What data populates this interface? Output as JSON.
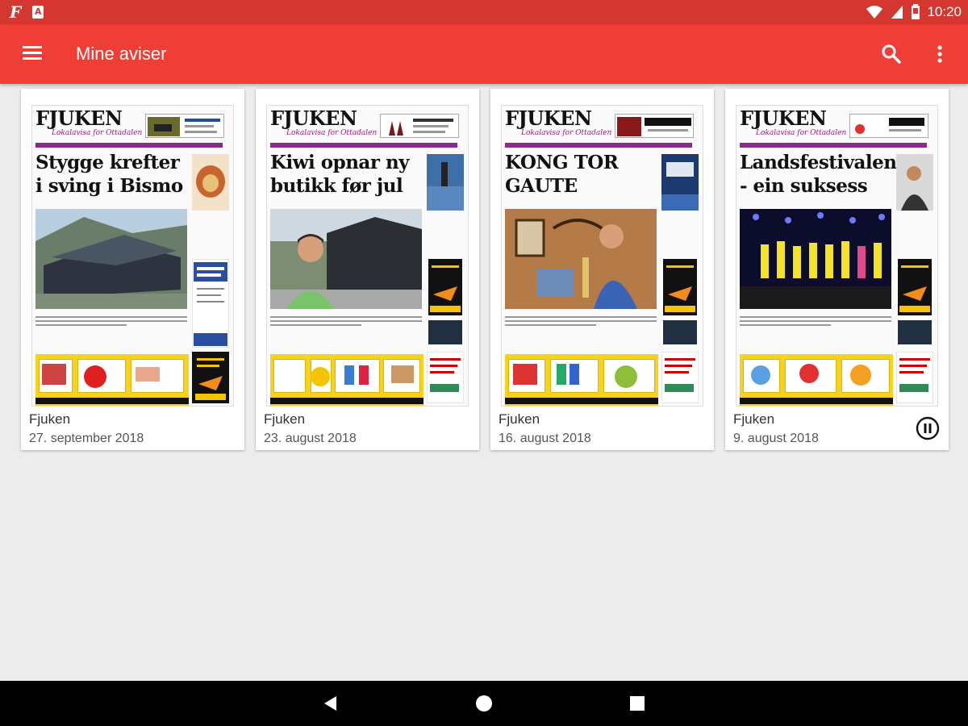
{
  "status_bar": {
    "time": "10:20",
    "app_icon_letter": "F",
    "notification_icon_letter": "A",
    "icons": [
      "wifi-icon",
      "cell-signal-icon",
      "battery-icon"
    ],
    "color": "#d33730"
  },
  "app_bar": {
    "title": "Mine aviser",
    "color": "#ef3e36",
    "icons": [
      "menu-icon",
      "search-icon",
      "more-vert-icon"
    ]
  },
  "papers": [
    {
      "name": "Fjuken",
      "date": "27. september 2018",
      "logo": "FJUKEN",
      "tagline": "Lokalavisa for Ottadalen",
      "headline": "Stygge krefter i sving i Bismo"
    },
    {
      "name": "Fjuken",
      "date": "23. august 2018",
      "logo": "FJUKEN",
      "tagline": "Lokalavisa for Ottadalen",
      "headline": "Kiwi opnar ny butikk før jul"
    },
    {
      "name": "Fjuken",
      "date": "16. august 2018",
      "logo": "FJUKEN",
      "tagline": "Lokalavisa for Ottadalen",
      "headline": "KONG TOR GAUTE"
    },
    {
      "name": "Fjuken",
      "date": "9. august 2018",
      "logo": "FJUKEN",
      "tagline": "Lokalavisa for Ottadalen",
      "headline": "Landsfestivalen - ein suksess",
      "download_state_icon": "pause-icon"
    }
  ],
  "nav_bar": {
    "icons": [
      "back-icon",
      "home-icon",
      "recents-icon"
    ]
  }
}
